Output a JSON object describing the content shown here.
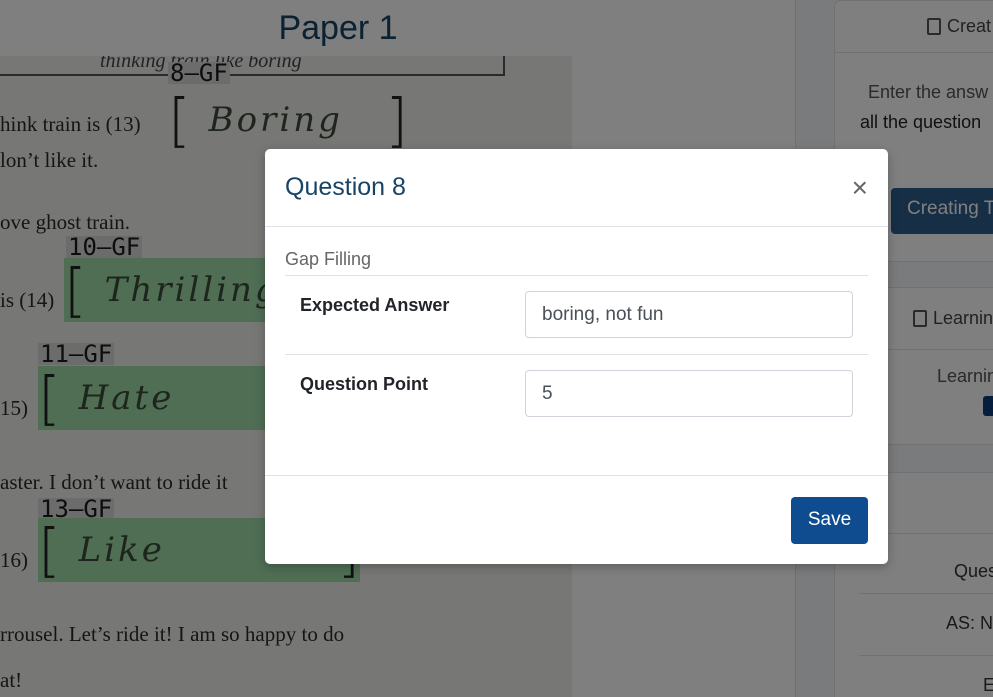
{
  "page": {
    "title": "Paper 1"
  },
  "scan": {
    "top_text": "thinking train like boring",
    "lines": [
      {
        "text": "hink train is (13)"
      },
      {
        "text": "lon’t like it."
      },
      {
        "text": "ove ghost train."
      },
      {
        "text": "is (14)"
      },
      {
        "text": "15)"
      },
      {
        "text": "aster. I don’t want to ride it"
      },
      {
        "text": "16)"
      },
      {
        "text": "rrousel. Let’s ride it! I am so happy to do"
      },
      {
        "text": "at!"
      }
    ],
    "tags": [
      "8—GF",
      "10—GF",
      "11—GF",
      "13—GF"
    ],
    "answers": [
      "Boring",
      "Thrilling",
      "Hate",
      "Like"
    ]
  },
  "right_panel": {
    "card1_title": "Creat",
    "instruction_line1": "Enter the answ",
    "instruction_line2": "all the question",
    "creating_button": "Creating T",
    "card2_title": "Learnin",
    "learning_text": "Learnin",
    "ques_text": "Ques",
    "as_text": "AS: N",
    "e_text": "E"
  },
  "modal": {
    "title": "Question 8",
    "close_symbol": "×",
    "section_label": "Gap Filling",
    "rows": [
      {
        "label": "Expected Answer",
        "value": "boring, not fun"
      },
      {
        "label": "Question Point",
        "value": "5"
      }
    ],
    "save_label": "Save"
  }
}
